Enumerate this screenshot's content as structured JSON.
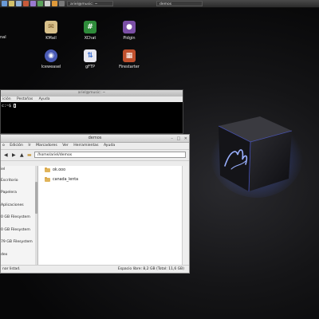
{
  "top_panel": {
    "tasks": [
      {
        "label": "ariel@music: ~"
      },
      {
        "label": "demos"
      }
    ]
  },
  "desktop": {
    "left_label": "nal",
    "icons": [
      {
        "label": "KMail",
        "name": "kmail-icon",
        "color": "#d8c08a",
        "glyph": "✉"
      },
      {
        "label": "XChat",
        "name": "xchat-icon",
        "color": "#2e8b3a",
        "glyph": "#"
      },
      {
        "label": "Pidgin",
        "name": "pidgin-icon",
        "color": "#7b4fa6",
        "glyph": "●"
      },
      {
        "label": "Iceweasel",
        "name": "iceweasel-icon",
        "color": "#4a5bb5",
        "glyph": "◉"
      },
      {
        "label": "gFTP",
        "name": "gftp-icon",
        "color": "#3b6fd1",
        "glyph": "⇅"
      },
      {
        "label": "Firestarter",
        "name": "firestarter-icon",
        "color": "#c0502d",
        "glyph": "▦"
      }
    ]
  },
  "terminal": {
    "title": "ariel@music: ~",
    "menu": [
      "ición",
      "Pestañas",
      "Ayuda"
    ],
    "prompt": "c:~$ "
  },
  "file_manager": {
    "title": "demos",
    "menu": [
      "o",
      "Edición",
      "Ir",
      "Marcadores",
      "Ver",
      "Herramientas",
      "Ayuda"
    ],
    "path": "/home/ariel/demos",
    "sidebar": [
      "iel",
      "Escritorio",
      "Papelera",
      "Aplicaciones",
      "0 GB Filesystem",
      "0 GB Filesystem",
      "79 GB Filesystem",
      "dex"
    ],
    "files": [
      "ok.ooo",
      "canada_lenta"
    ],
    "status_left": "nar listad.",
    "status_right": "Espacio libre: 8,2 GB (Total: 11,6 GB)"
  },
  "colors": {
    "cube_glow": "#4a6bff",
    "folder": "#e0b45a"
  }
}
